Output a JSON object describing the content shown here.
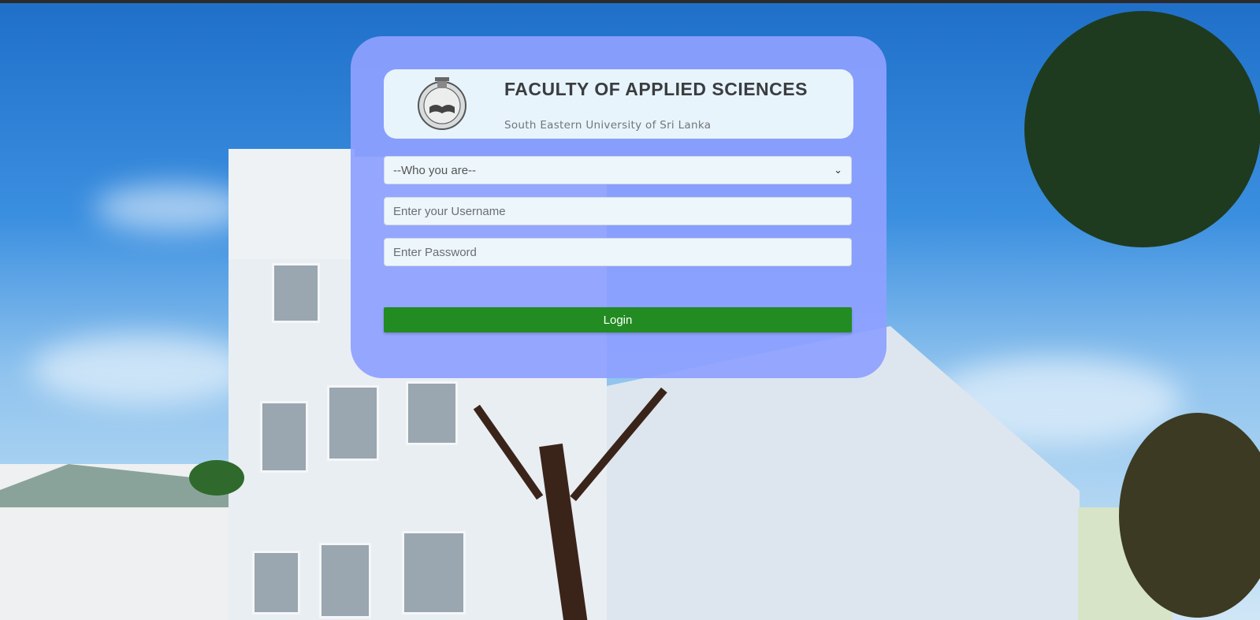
{
  "header": {
    "title": "FACULTY OF APPLIED SCIENCES",
    "subtitle": "South Eastern University of Sri Lanka",
    "logo_icon": "university-crest-icon"
  },
  "form": {
    "role_select": {
      "selected": "--Who you are--"
    },
    "username": {
      "value": "",
      "placeholder": "Enter your Username"
    },
    "password": {
      "value": "",
      "placeholder": "Enter Password"
    },
    "login_label": "Login"
  },
  "colors": {
    "card_bg": "#8ea0ff",
    "login_button": "#228b22",
    "header_box": "#e8f4fb"
  }
}
